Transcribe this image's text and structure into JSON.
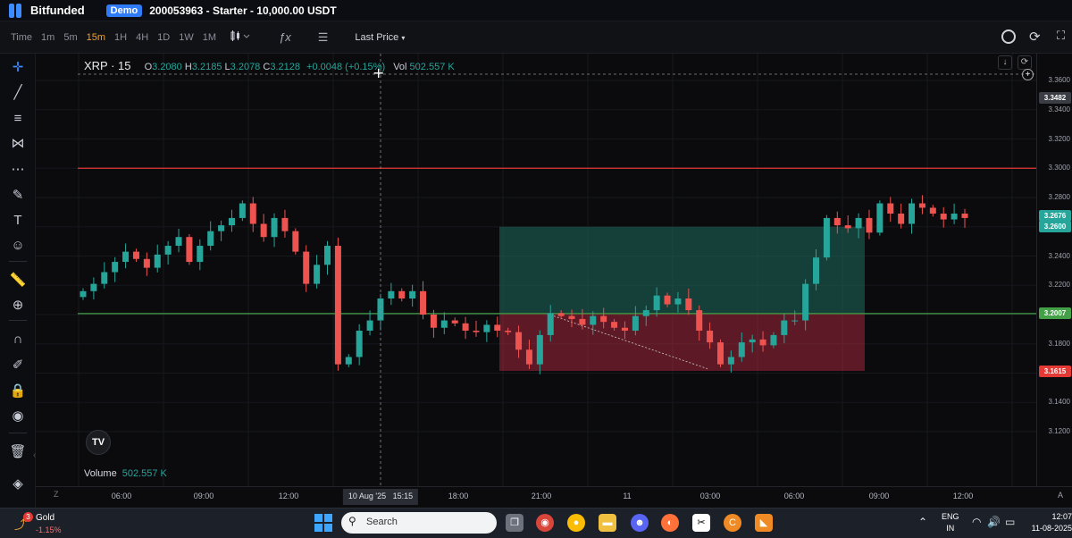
{
  "app": {
    "name": "Bitfunded",
    "mode_badge": "Demo",
    "account_info": "200053963 - Starter - 10,000.00 USDT"
  },
  "toolbar": {
    "time_label": "Time",
    "timeframes": [
      "1m",
      "5m",
      "15m",
      "1H",
      "4H",
      "1D",
      "1W",
      "1M"
    ],
    "active_timeframe": "15m",
    "price_type": "Last Price"
  },
  "legend": {
    "symbol": "XRP · 15",
    "open_key": "O",
    "open": "3.2080",
    "high_key": "H",
    "high": "3.2185",
    "low_key": "L",
    "low": "3.2078",
    "close_key": "C",
    "close": "3.2128",
    "change": "+0.0048 (+0.15%)",
    "vol_key": "Vol",
    "vol": "502.557 K"
  },
  "volume": {
    "label": "Volume",
    "value": "502.557 K"
  },
  "tv_logo": "TV",
  "price_axis": {
    "ticks": [
      "3.3600",
      "3.3400",
      "3.3200",
      "3.3000",
      "3.2800",
      "3.2600",
      "3.2400",
      "3.2200",
      "3.2000",
      "3.1800",
      "3.1600",
      "3.1400",
      "3.1200"
    ],
    "crosshair_label": "3.3482",
    "current_price": "3.2676",
    "target_price": "3.2600",
    "entry_price": "3.2007",
    "stop_price": "3.1615"
  },
  "time_axis": {
    "ticks": [
      "06:00",
      "09:00",
      "12:00",
      "18:00",
      "21:00",
      "11",
      "03:00",
      "06:00",
      "09:00",
      "12:00"
    ],
    "crosshair_label": "10 Aug '25   15:15",
    "z_label": "Z",
    "a_label": "A"
  },
  "colors": {
    "up": "#26a69a",
    "down": "#ef5350",
    "resistance_line": "#e53935",
    "entry_line": "#43a047",
    "profit_zone": "#1f6b5c",
    "loss_zone": "#a3283a",
    "accent": "#3d8bff"
  },
  "chart_data": {
    "type": "candlestick",
    "symbol": "XRP",
    "interval": "15m",
    "ylim": [
      3.1,
      3.37
    ],
    "horizontal_lines": [
      3.3,
      3.2007
    ],
    "position": {
      "entry": 3.2007,
      "target": 3.26,
      "stop": 3.1615
    },
    "close_series": [
      3.216,
      3.221,
      3.229,
      3.236,
      3.243,
      3.238,
      3.232,
      3.241,
      3.247,
      3.253,
      3.236,
      3.247,
      3.257,
      3.261,
      3.266,
      3.276,
      3.262,
      3.253,
      3.266,
      3.257,
      3.243,
      3.221,
      3.234,
      3.247,
      3.166,
      3.171,
      3.189,
      3.196,
      3.211,
      3.216,
      3.211,
      3.216,
      3.2,
      3.191,
      3.196,
      3.194,
      3.189,
      3.188,
      3.193,
      3.189,
      3.188,
      3.176,
      3.166,
      3.186,
      3.201,
      3.199,
      3.197,
      3.193,
      3.199,
      3.195,
      3.191,
      3.189,
      3.199,
      3.203,
      3.213,
      3.207,
      3.211,
      3.203,
      3.189,
      3.181,
      3.166,
      3.171,
      3.181,
      3.183,
      3.179,
      3.186,
      3.196,
      3.196,
      3.221,
      3.239,
      3.266,
      3.261,
      3.259,
      3.266,
      3.256,
      3.276,
      3.269,
      3.262,
      3.276,
      3.273,
      3.269,
      3.265,
      3.269,
      3.266
    ]
  },
  "taskbar": {
    "weather_name": "Gold",
    "weather_change": "-1.15%",
    "weather_badge": "3",
    "search": "Search",
    "lang_top": "ENG",
    "lang_bottom": "IN",
    "time": "12:07",
    "date": "11-08-2025"
  }
}
